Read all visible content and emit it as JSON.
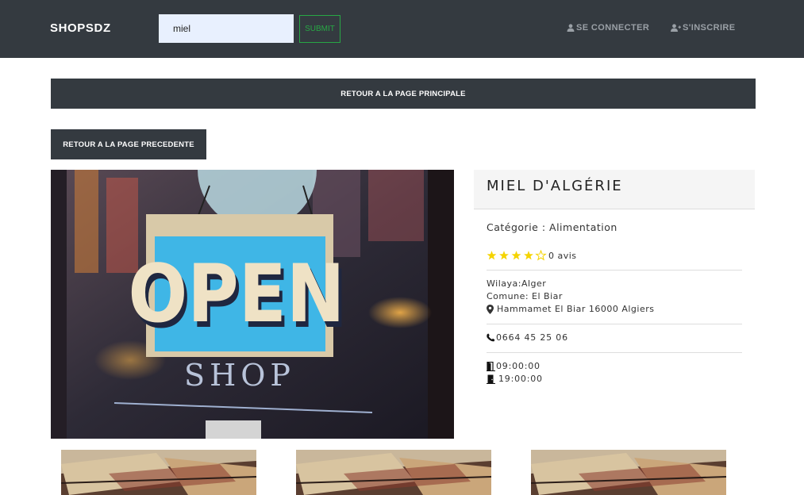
{
  "header": {
    "brand": "SHOPSDZ",
    "search": {
      "value": "miel"
    },
    "submit_label": "SUBMIT",
    "login_label": "SE CONNECTER",
    "register_label": "S'INSCRIRE"
  },
  "nav": {
    "back_main": "RETOUR A LA PAGE PRINCIPALE",
    "back_previous": "RETOUR A LA PAGE PRECEDENTE"
  },
  "shop": {
    "image": {
      "sign_word": "OPEN",
      "window_word": "SHOP"
    },
    "title": "MIEL D'ALGÉRIE",
    "category": "Catégorie : Alimentation",
    "rating": 4,
    "rating_max": 5,
    "reviews": "0 avis",
    "wilaya": "Wilaya:Alger",
    "commune": "Comune: El Biar",
    "address": "Hammamet El Biar 16000 Algiers",
    "phone": "0664 45 25 06",
    "open_time": "09:00:00",
    "close_time": "19:00:00"
  },
  "colors": {
    "navbar": "#343a40",
    "submit_outline": "#28a745",
    "star": "#f5d400",
    "sign_blue": "#3fb6e6"
  },
  "icons": {
    "login": "user-icon",
    "register": "user-plus-icon",
    "location": "map-marker-icon",
    "phone": "phone-icon",
    "open": "door-open-icon",
    "close": "door-closed-icon"
  }
}
